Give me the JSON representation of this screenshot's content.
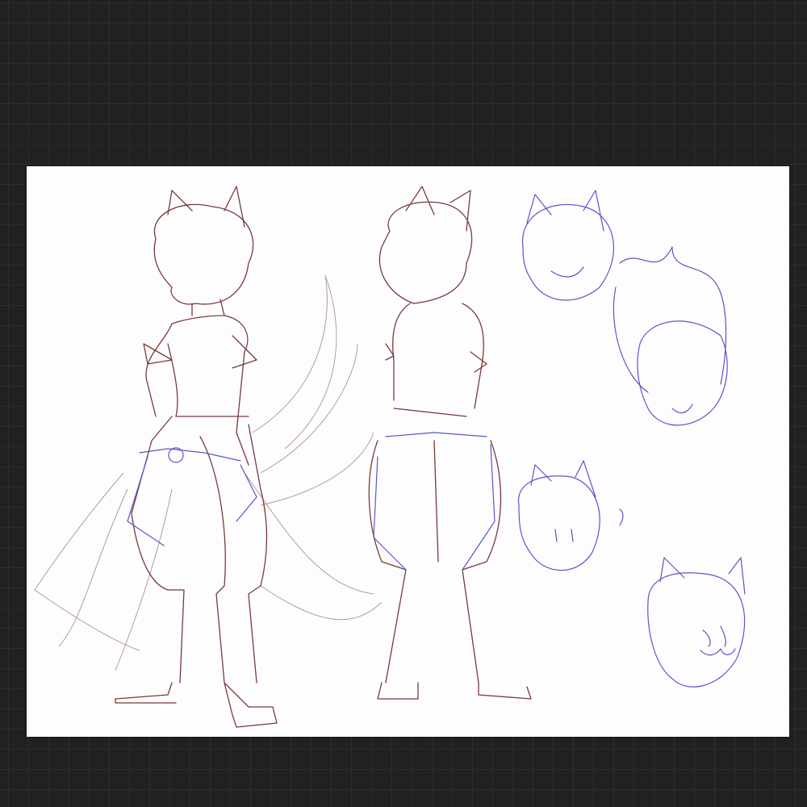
{
  "canvas": {
    "background_color": "#212121",
    "grid_color": "#2d2d2d",
    "paper_color": "#fdfdfd"
  },
  "artwork": {
    "line_colors": {
      "figures": "#7a3a3a",
      "heads_and_details": "#5a55c8"
    }
  }
}
